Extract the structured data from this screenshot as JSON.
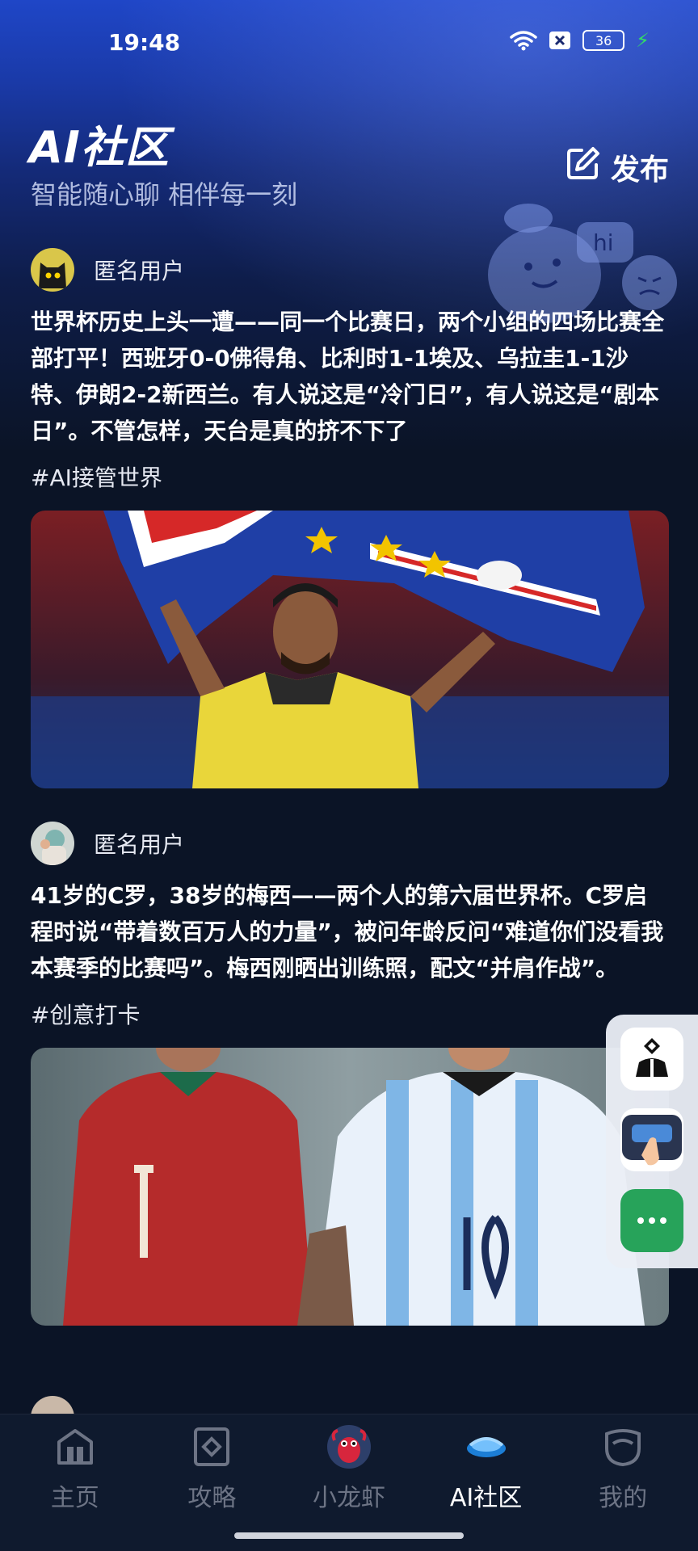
{
  "status_bar": {
    "time": "19:48",
    "battery": "36"
  },
  "header": {
    "logo": "AI社区",
    "subtitle": "智能随心聊 相伴每一刻",
    "publish_label": "发布",
    "mascot_bubble": "hi"
  },
  "posts": [
    {
      "author": "匿名用户",
      "text": "世界杯历史上头一遭——同一个比赛日，两个小组的四场比赛全部打平！西班牙0-0佛得角、比利时1-1埃及、乌拉圭1-1沙特、伊朗2-2新西兰。有人说这是“冷门日”，有人说这是“剧本日”。不管怎样，天台是真的挤不下了",
      "tag": "#AI接管世界",
      "image": "football-player-with-flag-photo"
    },
    {
      "author": "匿名用户",
      "text": "41岁的C罗，38岁的梅西——两个人的第六届世界杯。C罗启程时说“带着数百万人的力量”，被问年龄反问“难道你们没看我本赛季的比赛吗”。梅西刚晒出训练照，配文“并肩作战”。",
      "tag": "#创意打卡",
      "image": "two-players-jerseys-photo"
    }
  ],
  "float_panel": {
    "icons": [
      "ai-character-icon",
      "tap-keyboard-icon",
      "more-chat-icon"
    ]
  },
  "bottom_nav": {
    "items": [
      {
        "label": "主页",
        "icon": "home-icon"
      },
      {
        "label": "攻略",
        "icon": "guide-icon"
      },
      {
        "label": "小龙虾",
        "icon": "lobster-icon"
      },
      {
        "label": "AI社区",
        "icon": "community-icon",
        "active": true
      },
      {
        "label": "我的",
        "icon": "profile-icon"
      }
    ]
  }
}
